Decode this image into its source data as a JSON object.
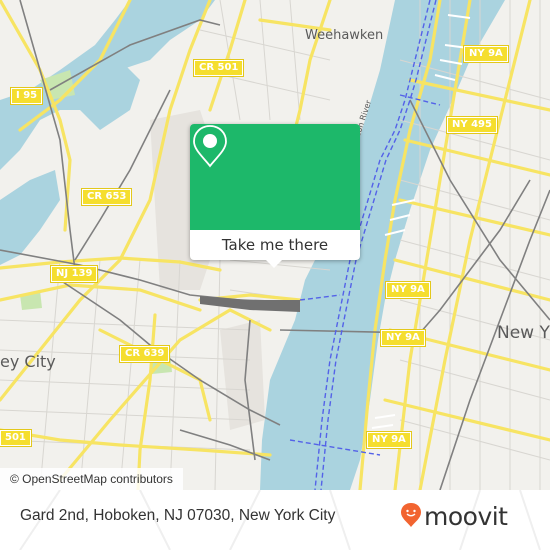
{
  "map": {
    "colors": {
      "land": "#f2f1ed",
      "water": "#aad3df",
      "road_major": "#f7e463",
      "rail": "#777777",
      "ferry": "#5462e8",
      "park": "#c8e6b0"
    },
    "labels": {
      "places": [
        "Weehawken",
        "New Y",
        "ey City"
      ],
      "water": [
        "Hudson River"
      ],
      "shields": [
        "CR 501",
        "I 95",
        "CR 653",
        "NJ 139",
        "NY 9A",
        "NY 495",
        "NY 9A",
        "CR 639",
        "NY 9A",
        "NY 9A",
        "501"
      ]
    },
    "attribution": "© OpenStreetMap contributors"
  },
  "popup": {
    "icon": "map-pin-icon",
    "cta_label": "Take me there",
    "accent": "#1db86a"
  },
  "footer": {
    "address": "Gard 2nd, Hoboken, NJ 07030, New York City",
    "brand": "moovit",
    "brand_color": "#f26430"
  }
}
